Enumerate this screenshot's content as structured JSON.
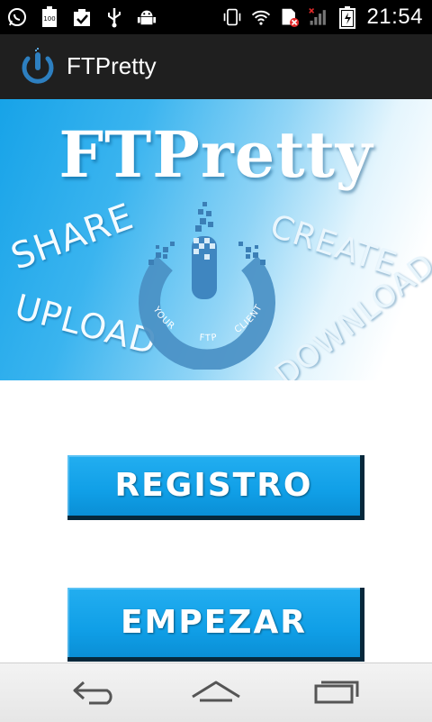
{
  "status_bar": {
    "time": "21:54",
    "left_icons": [
      "whatsapp-icon",
      "battery-100-icon",
      "clipboard-check-icon",
      "usb-icon",
      "android-debug-icon"
    ],
    "right_icons": [
      "vibrate-icon",
      "wifi-icon",
      "sim-error-icon",
      "signal-off-icon",
      "battery-charging-icon"
    ],
    "battery_badge": "100"
  },
  "action_bar": {
    "title": "FTPretty",
    "logo_icon": "ftp-power-logo-icon"
  },
  "banner": {
    "title": "FTPretty",
    "words": {
      "share": "SHARE",
      "upload": "UPLOAD",
      "create": "CREATE",
      "download": "DOWNLOAD"
    },
    "logo": {
      "your": "YOUR",
      "ftp": "FTP",
      "client": "CLIENT"
    }
  },
  "buttons": {
    "registro": "REGISTRO",
    "empezar": "EMPEZAR"
  },
  "nav_bar": {
    "icons": [
      "back-icon",
      "home-icon",
      "recent-apps-icon"
    ]
  },
  "colors": {
    "banner_blue": "#17a3e8",
    "button_blue": "#109fe7",
    "action_bar": "#1f1f1f",
    "logo_blue": "#4a90c4"
  }
}
